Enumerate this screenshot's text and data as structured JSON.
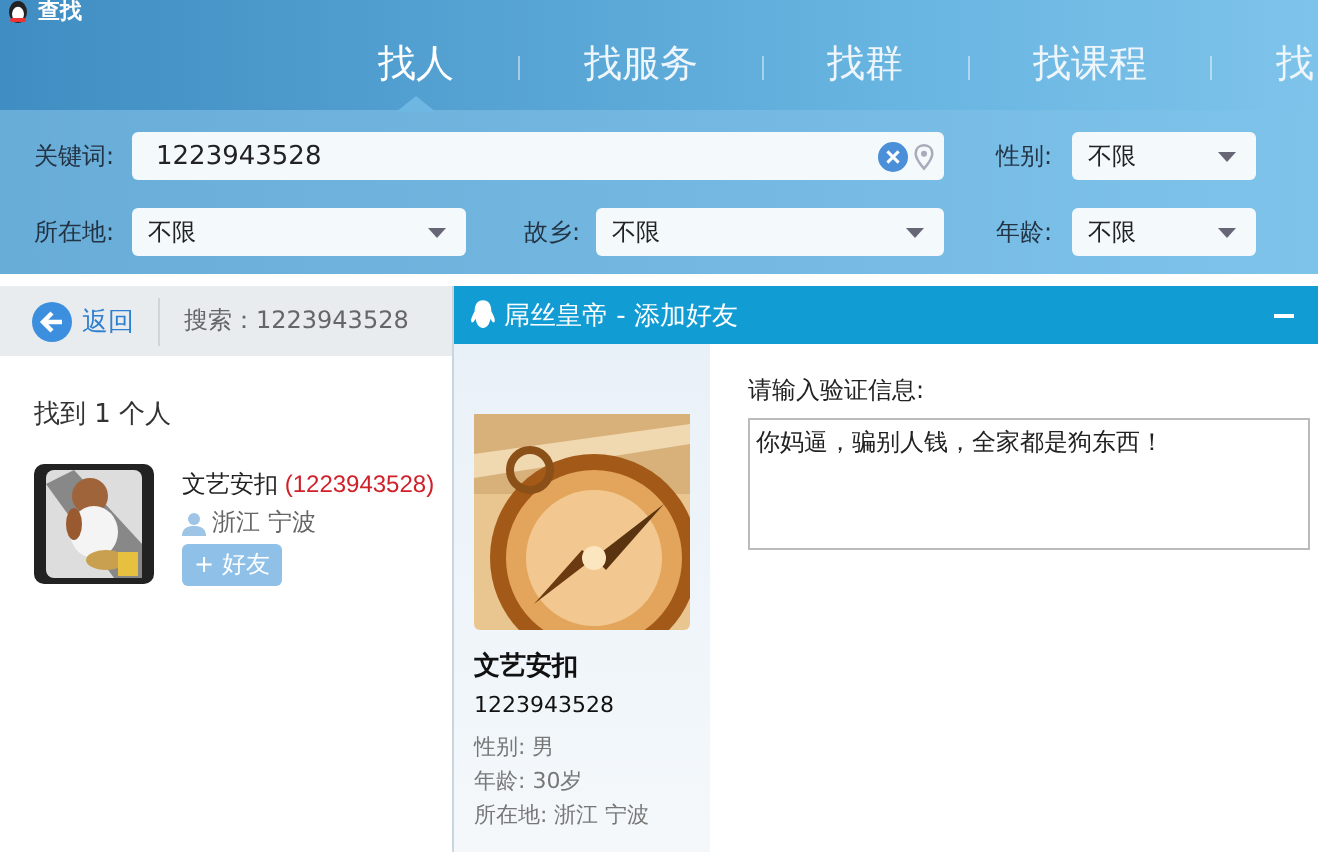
{
  "window": {
    "title": "查找"
  },
  "tabs": [
    {
      "label": "找人",
      "selected": true
    },
    {
      "label": "找服务",
      "selected": false
    },
    {
      "label": "找群",
      "selected": false
    },
    {
      "label": "找课程",
      "selected": false
    },
    {
      "label": "找",
      "selected": false
    }
  ],
  "filters": {
    "keyword": {
      "label": "关键词:",
      "value": "1223943528"
    },
    "gender": {
      "label": "性别:",
      "value": "不限"
    },
    "location": {
      "label": "所在地:",
      "value": "不限"
    },
    "hometown": {
      "label": "故乡:",
      "value": "不限"
    },
    "age": {
      "label": "年龄:",
      "value": "不限"
    }
  },
  "toolbar": {
    "back": "返回",
    "search": "搜索：1223943528"
  },
  "results": {
    "summary": "找到 1 个人",
    "people": [
      {
        "name": "文艺安扣",
        "id": "(1223943528)",
        "location": "浙江 宁波",
        "button": "+ 好友"
      }
    ]
  },
  "dialog": {
    "title": "屌丝皇帝 - 添加好友",
    "profile": {
      "name": "文艺安扣",
      "id": "1223943528",
      "details": [
        "性别: 男",
        "年龄: 30岁",
        "所在地: 浙江  宁波"
      ]
    },
    "prompt": "请输入验证信息:",
    "message": "你妈逼，骗别人钱，全家都是狗东西！"
  }
}
